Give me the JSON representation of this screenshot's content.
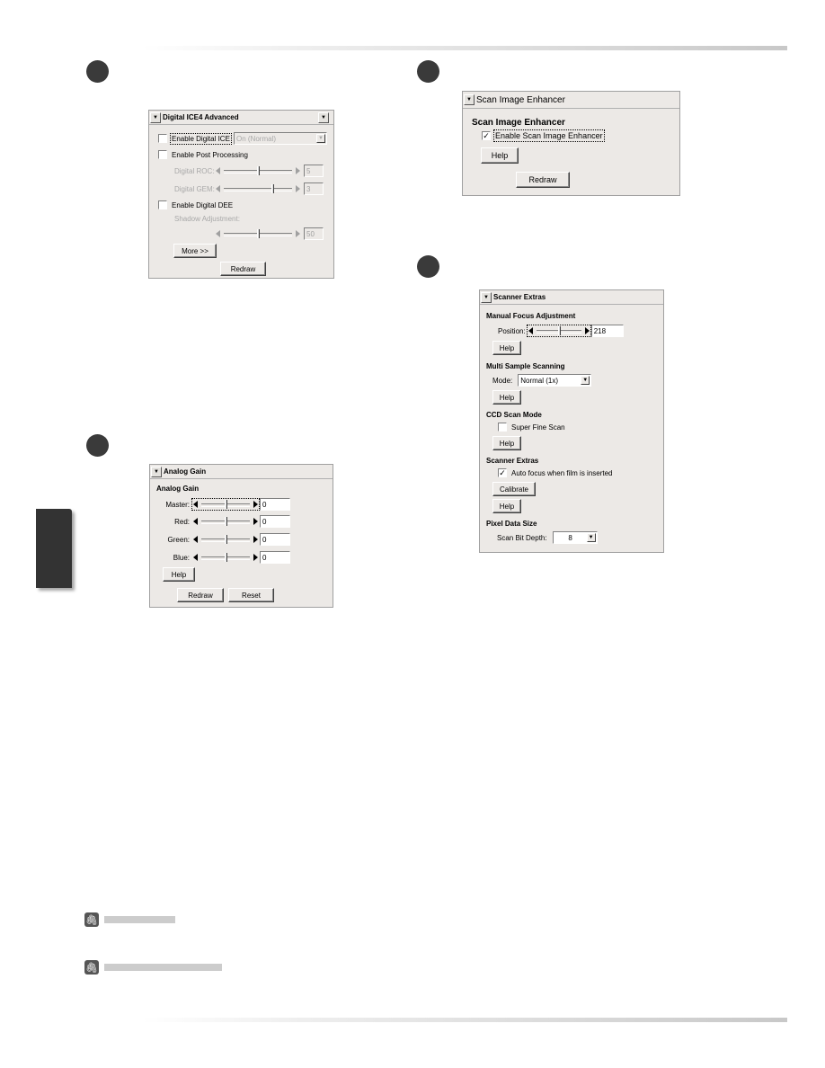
{
  "page": {
    "note_icon": "paperclip-icon",
    "side_tab_icon": "chapter-tab"
  },
  "ice": {
    "title": "Digital ICE4 Advanced",
    "enable_ice_label": "Enable Digital ICE",
    "enable_ice_checked": false,
    "ice_mode": "On (Normal)",
    "enable_post_label": "Enable Post Processing",
    "enable_post_checked": false,
    "roc_label": "Digital ROC:",
    "roc_value": "5",
    "gem_label": "Digital GEM:",
    "gem_value": "3",
    "enable_dee_label": "Enable Digital DEE",
    "enable_dee_checked": false,
    "shadow_label": "Shadow Adjustment:",
    "shadow_value": "50",
    "more_label": "More >>",
    "redraw_label": "Redraw"
  },
  "sie": {
    "title": "Scan Image Enhancer",
    "section": "Scan Image Enhancer",
    "enable_label": "Enable Scan Image Enhancer",
    "enable_checked": true,
    "help_label": "Help",
    "redraw_label": "Redraw"
  },
  "gain": {
    "title": "Analog Gain",
    "section": "Analog Gain",
    "channels": [
      {
        "label": "Master:",
        "value": "0"
      },
      {
        "label": "Red:",
        "value": "0"
      },
      {
        "label": "Green:",
        "value": "0"
      },
      {
        "label": "Blue:",
        "value": "0"
      }
    ],
    "help_label": "Help",
    "redraw_label": "Redraw",
    "reset_label": "Reset"
  },
  "extras": {
    "title": "Scanner Extras",
    "focus_section": "Manual Focus Adjustment",
    "position_label": "Position:",
    "position_value": "218",
    "help_label": "Help",
    "multi_section": "Multi Sample Scanning",
    "mode_label": "Mode:",
    "mode_value": "Normal (1x)",
    "ccd_section": "CCD Scan Mode",
    "super_fine_label": "Super Fine Scan",
    "super_fine_checked": false,
    "extras_section": "Scanner Extras",
    "autofocus_label": "Auto focus when film is inserted",
    "autofocus_checked": true,
    "calibrate_label": "Calibrate",
    "pixel_section": "Pixel Data Size",
    "bitdepth_label": "Scan Bit Depth:",
    "bitdepth_value": "8"
  }
}
